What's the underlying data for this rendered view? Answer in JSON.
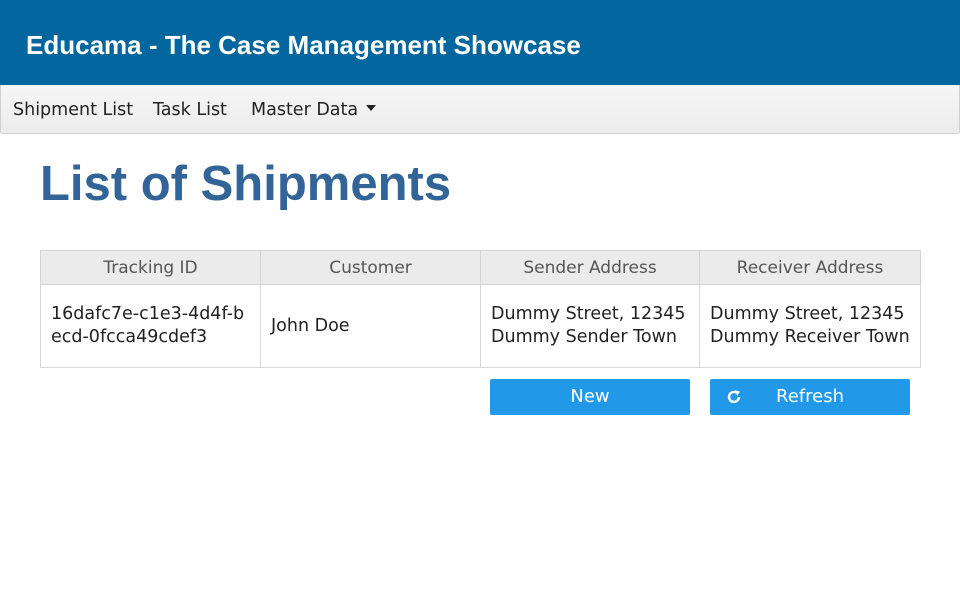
{
  "header": {
    "app_title": "Educama - The Case Management Showcase"
  },
  "menu": {
    "items": [
      {
        "label": "Shipment List"
      },
      {
        "label": "Task List"
      },
      {
        "label": "Master Data",
        "icon": "caret-down-icon"
      }
    ]
  },
  "main": {
    "title": "List of Shipments",
    "table": {
      "columns": [
        "Tracking ID",
        "Customer",
        "Sender Address",
        "Receiver Address"
      ],
      "rows": [
        {
          "tracking_id": "16dafc7e-c1e3-4d4f-becd-0fcca49cdef3",
          "customer": "John Doe",
          "sender_address": "Dummy Street, 12345 Dummy Sender Town",
          "receiver_address": "Dummy Street, 12345 Dummy Receiver Town"
        }
      ]
    },
    "buttons": {
      "new_label": "New",
      "refresh_label": "Refresh",
      "refresh_icon": "refresh-icon"
    }
  },
  "colors": {
    "header_bg": "#03669e",
    "title": "#336497",
    "button": "#2199e8"
  }
}
